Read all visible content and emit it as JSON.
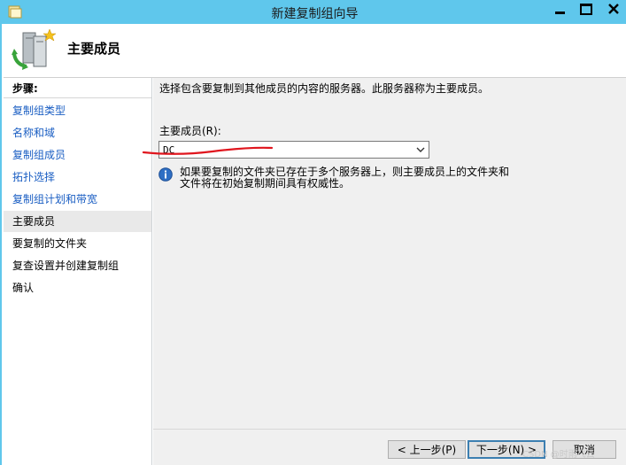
{
  "window": {
    "title": "新建复制组向导"
  },
  "header": {
    "title": "主要成员"
  },
  "sidebar": {
    "heading": "步骤:",
    "items": [
      {
        "label": "复制组类型",
        "state": "link"
      },
      {
        "label": "名称和域",
        "state": "link"
      },
      {
        "label": "复制组成员",
        "state": "link"
      },
      {
        "label": "拓扑选择",
        "state": "link"
      },
      {
        "label": "复制组计划和带宽",
        "state": "link"
      },
      {
        "label": "主要成员",
        "state": "current"
      },
      {
        "label": "要复制的文件夹",
        "state": "plain"
      },
      {
        "label": "复查设置并创建复制组",
        "state": "plain"
      },
      {
        "label": "确认",
        "state": "plain"
      }
    ]
  },
  "main": {
    "description": "选择包含要复制到其他成员的内容的服务器。此服务器称为主要成员。",
    "field_label": "主要成员(R):",
    "selected_value": "DC",
    "info_line1": "如果要复制的文件夹已存在于多个服务器上，则主要成员上的文件夹和",
    "info_line2": "文件将在初始复制期间具有权威性。"
  },
  "buttons": {
    "prev": "< 上一步(P)",
    "next": "下一步(N) >",
    "cancel": "取消"
  },
  "watermark": "CSDN @时雨飞云",
  "colors": {
    "titlebar": "#5fc7ec",
    "link": "#1a5ec3",
    "annotation": "#e0161e"
  }
}
